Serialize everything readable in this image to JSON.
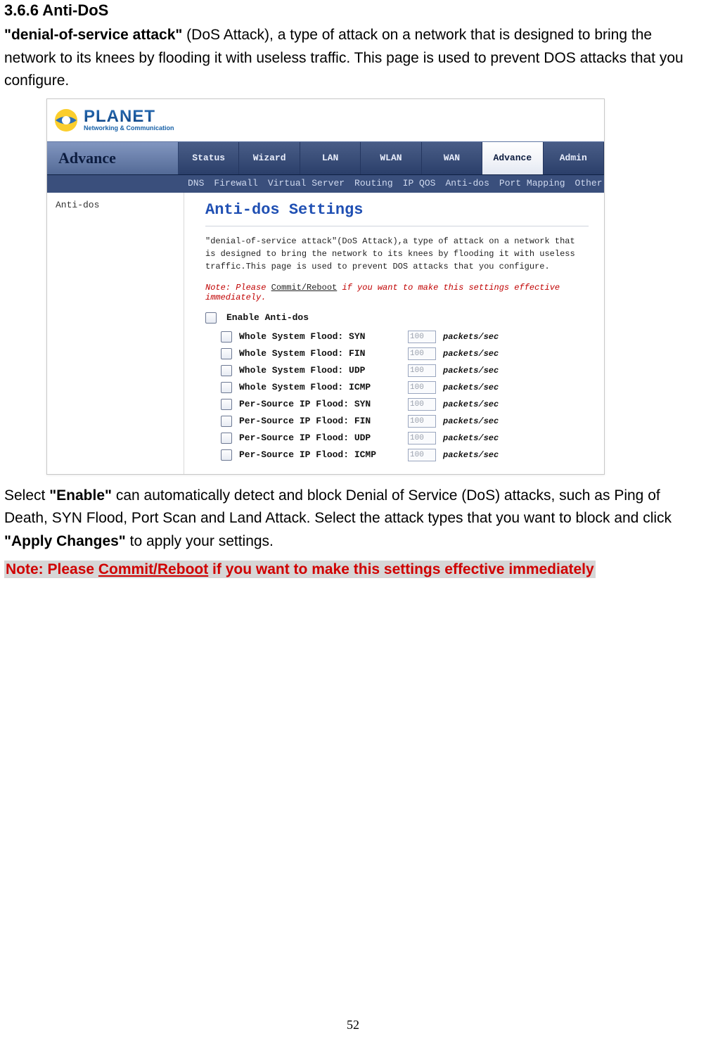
{
  "section": {
    "heading": "3.6.6 Anti-DoS",
    "intro_bold": "\"denial-of-service attack\"",
    "intro_rest": " (DoS Attack), a type of attack on a network that is designed to bring the network to its knees by flooding it with useless traffic. This page is used to prevent DOS attacks that you configure.",
    "after_1a": "Select ",
    "after_1b": "\"Enable\"",
    "after_1c": " can automatically detect and block Denial of Service (DoS) attacks, such as Ping of Death, SYN Flood, Port Scan and Land Attack. Select the attack types that you want to block and click ",
    "after_1d": "\"Apply Changes\"",
    "after_1e": " to apply your settings.",
    "note_a": "Note: Please ",
    "note_b": "Commit/Reboot",
    "note_c": " if you want to make this settings effective immediately"
  },
  "screenshot": {
    "brand": "PLANET",
    "brand_sub": "Networking & Communication",
    "nav_left": "Advance",
    "tabs": [
      "Status",
      "Wizard",
      "LAN",
      "WLAN",
      "WAN",
      "Advance",
      "Admin"
    ],
    "active_tab_index": 5,
    "sub_items": [
      "DNS",
      "Firewall",
      "Virtual Server",
      "Routing",
      "IP QOS",
      "Anti-dos",
      "Port Mapping",
      "Other"
    ],
    "sidebar_item": "Anti-dos",
    "panel_title": "Anti-dos Settings",
    "panel_desc": "\"denial-of-service attack\"(DoS Attack),a type of attack on a network that is designed to bring the network to its knees by flooding it with useless traffic.This page is used to prevent DOS attacks that you configure.",
    "panel_note_a": "Note: Please ",
    "panel_note_b": "Commit/Reboot",
    "panel_note_c": " if you want to make this settings effective immediately.",
    "enable_label": "Enable Anti-dos",
    "options": [
      {
        "label": "Whole System Flood: SYN",
        "value": "100",
        "unit": "packets/sec"
      },
      {
        "label": "Whole System Flood: FIN",
        "value": "100",
        "unit": "packets/sec"
      },
      {
        "label": "Whole System Flood: UDP",
        "value": "100",
        "unit": "packets/sec"
      },
      {
        "label": "Whole System Flood: ICMP",
        "value": "100",
        "unit": "packets/sec"
      },
      {
        "label": "Per-Source IP Flood: SYN",
        "value": "100",
        "unit": "packets/sec"
      },
      {
        "label": "Per-Source IP Flood: FIN",
        "value": "100",
        "unit": "packets/sec"
      },
      {
        "label": "Per-Source IP Flood: UDP",
        "value": "100",
        "unit": "packets/sec"
      },
      {
        "label": "Per-Source IP Flood: ICMP",
        "value": "100",
        "unit": "packets/sec"
      }
    ]
  },
  "page_number": "52"
}
